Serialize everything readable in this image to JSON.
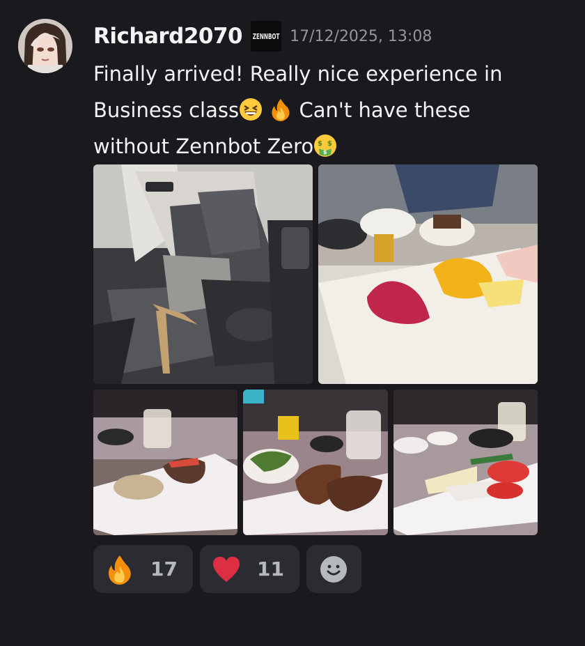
{
  "message": {
    "author": "Richard2070",
    "clan_tag": "ZENNBOT",
    "timestamp": "17/12/2025, 13:08",
    "text_part1": "Finally arrived! Really nice experience in Business class",
    "text_part2": " Can't have these without Zennbot Zero",
    "emojis": [
      "grinning-squinting-face-icon",
      "fire-icon",
      "money-mouth-face-icon"
    ]
  },
  "attachments": [
    {
      "name": "business-class-seat-photo"
    },
    {
      "name": "dessert-plate-photo"
    },
    {
      "name": "appetizer-plate-photo"
    },
    {
      "name": "main-course-plate-photo"
    },
    {
      "name": "cheese-plate-photo"
    }
  ],
  "reactions": [
    {
      "emoji": "fire-icon",
      "count": "17"
    },
    {
      "emoji": "red-heart-icon",
      "count": "11"
    }
  ],
  "colors": {
    "background": "#1a1a1e",
    "reaction_bg": "#2b2c31",
    "username": "#f2f3f5",
    "timestamp": "#94969c"
  }
}
